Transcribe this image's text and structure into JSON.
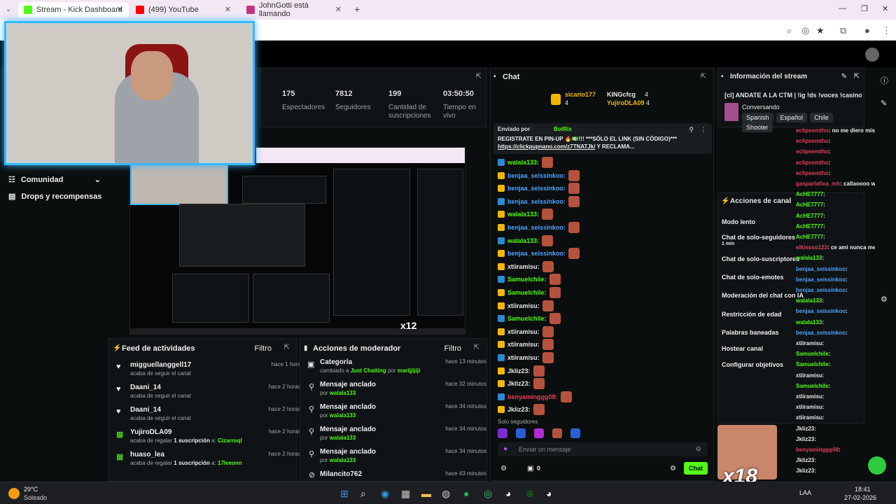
{
  "browser": {
    "tabs": [
      {
        "label": "Stream - Kick Dashboard",
        "active": true,
        "color": "#53fc18"
      },
      {
        "label": "(499) YouTube",
        "active": false,
        "color": "#ff0000"
      },
      {
        "label": "JohnGotti está llamando",
        "active": false,
        "color": "#c13584"
      }
    ],
    "new_tab": "+"
  },
  "stats": [
    {
      "value": "175",
      "label": "Espectadores"
    },
    {
      "value": "7812",
      "label": "Seguidores"
    },
    {
      "value": "199",
      "label": "Cantidad de suscripciones"
    },
    {
      "value": "03:50:50",
      "label": "Tiempo en vivo"
    }
  ],
  "sidebar": {
    "items": [
      {
        "label": "Comunidad",
        "icon": "users-icon"
      },
      {
        "label": "Drops y recompensas",
        "icon": "gift-icon"
      }
    ]
  },
  "activity_feed": {
    "title": "Feed de actividades",
    "filter": "Filtro",
    "rows": [
      {
        "name": "migguellanggell17",
        "sub": "acaba de seguir el canal",
        "time": "hace 1 hora",
        "type": "follow"
      },
      {
        "name": "Daani_14",
        "sub": "acaba de seguir el canal",
        "time": "hace 2 horas",
        "type": "follow"
      },
      {
        "name": "Daani_14",
        "sub": "acaba de seguir el canal",
        "time": "hace 2 horas",
        "type": "follow"
      },
      {
        "name": "YujiroDLA09",
        "sub_pre": "acaba de regalar",
        "sub_mid": "1 suscripción",
        "sub_post": "a:",
        "target": "Cizarroql",
        "time": "hace 2 horas",
        "type": "gift"
      },
      {
        "name": "huaso_lea",
        "sub_pre": "acaba de regalar",
        "sub_mid": "1 suscripción",
        "sub_post": "a:",
        "target": "17leeonn",
        "time": "hace 2 horas",
        "type": "gift"
      }
    ]
  },
  "mod_actions": {
    "title": "Acciones de moderador",
    "filter": "Filtro",
    "rows": [
      {
        "title": "Categoría",
        "sub_pre": "cambiado a",
        "sub_mid": "Just Chatting",
        "sub_post": "por",
        "by": "marijjijiji",
        "time": "hace 13 minutos"
      },
      {
        "title": "Mensaje anclado",
        "sub_pre": "por",
        "by": "walala133",
        "time": "hace 32 minutos"
      },
      {
        "title": "Mensaje anclado",
        "sub_pre": "por",
        "by": "walala133",
        "time": "hace 34 minutos"
      },
      {
        "title": "Mensaje anclado",
        "sub_pre": "por",
        "by": "walala133",
        "time": "hace 34 minutos"
      },
      {
        "title": "Mensaje anclado",
        "sub_pre": "por",
        "by": "walala133",
        "time": "hace 34 minutos"
      },
      {
        "title": "Milancito762",
        "time": "hace 43 minutos"
      }
    ]
  },
  "chat": {
    "title": "Chat",
    "leaders": [
      "sicario177",
      "KINGcfcg",
      "YujiroDLA09"
    ],
    "leader_counts": [
      "4",
      "4",
      "4"
    ],
    "pinned_by": "Enviado por",
    "pinned_user": "BotRix",
    "pinned_text": "REGISTRATE EN PIN-UP 🔥💵!!! ***SÓLO EL LINK (SIN CÓDIGO)***",
    "pinned_link": "https://clickpupnano.com/z7TNATJk/",
    "pinned_tail": "Y RECLAMA...",
    "messages": [
      {
        "user": "walala133:",
        "color": "#53fc18"
      },
      {
        "user": "benjaa_seissinkoo:",
        "color": "#4da3ff"
      },
      {
        "user": "benjaa_seissinkoo:",
        "color": "#4da3ff"
      },
      {
        "user": "benjaa_seissinkoo:",
        "color": "#4da3ff"
      },
      {
        "user": "walala133:",
        "color": "#53fc18"
      },
      {
        "user": "benjaa_seissinkoo:",
        "color": "#4da3ff"
      },
      {
        "user": "walala133:",
        "color": "#53fc18"
      },
      {
        "user": "benjaa_seissinkoo:",
        "color": "#4da3ff"
      },
      {
        "user": "xtiiramisu:",
        "color": "#e6e6e6"
      },
      {
        "user": "Samuelchile:",
        "color": "#53fc18"
      },
      {
        "user": "Samuelchile:",
        "color": "#53fc18"
      },
      {
        "user": "xtiiramisu:",
        "color": "#e6e6e6"
      },
      {
        "user": "Samuelchile:",
        "color": "#53fc18"
      },
      {
        "user": "xtiiramisu:",
        "color": "#e6e6e6"
      },
      {
        "user": "xtiiramisu:",
        "color": "#e6e6e6"
      },
      {
        "user": "xtiiramisu:",
        "color": "#e6e6e6"
      },
      {
        "user": "Jkliz23:",
        "color": "#e6e6e6"
      },
      {
        "user": "Jkliz23:",
        "color": "#e6e6e6"
      },
      {
        "user": "benyaminggg08:",
        "color": "#e0415a"
      },
      {
        "user": "Jkliz23:",
        "color": "#e6e6e6"
      }
    ],
    "followers_only": "Solo seguidores",
    "input_placeholder": "Enviar un mensaje",
    "points": "0",
    "send": "Chat"
  },
  "stream_info": {
    "title": "Información del stream",
    "stream_title": "[cl] ANDATE A LA CTM | !ig !ds !voces !casino",
    "category": "Conversando",
    "tags": [
      "Spanish",
      "Español",
      "Chile",
      "Shooter"
    ]
  },
  "channel_actions": {
    "title": "Acciones de canal",
    "items": [
      {
        "label": "Modo lento"
      },
      {
        "label": "Chat de solo-seguidores",
        "sub": "1 min"
      },
      {
        "label": "Chat de solo-suscriptores"
      },
      {
        "label": "Chat de solo-emotes"
      },
      {
        "label": "Moderación del chat con IA"
      },
      {
        "label": "Restricción de edad"
      },
      {
        "label": "Palabras baneadas"
      },
      {
        "label": "Hostear canal"
      },
      {
        "label": "Configurar objetivos"
      }
    ]
  },
  "side_chat": [
    {
      "user": "eclipsemtho",
      "text": ": no me diero mis puntos",
      "color": "#e0415a"
    },
    {
      "user": "eclipsemtho",
      "text": ":",
      "color": "#e0415a"
    },
    {
      "user": "eclipsemtho",
      "text": ":",
      "color": "#e0415a"
    },
    {
      "user": "eclipsemtho",
      "text": ":",
      "color": "#e0415a"
    },
    {
      "user": "eclipsemtho",
      "text": ":",
      "color": "#e0415a"
    },
    {
      "user": "gasparlafixa_mh",
      "text": ": callaoooo wn",
      "color": "#e0415a"
    },
    {
      "user": "AcHE7777",
      "text": ":",
      "color": "#53fc18"
    },
    {
      "user": "AcHE7777",
      "text": ":",
      "color": "#53fc18"
    },
    {
      "user": "AcHE7777",
      "text": ":",
      "color": "#53fc18"
    },
    {
      "user": "AcHE7777",
      "text": ":",
      "color": "#53fc18"
    },
    {
      "user": "AcHE7777",
      "text": ":",
      "color": "#53fc18"
    },
    {
      "user": "elkissso123",
      "text": ": ce ami nunca me llegaron los puntos wawa",
      "color": "#e0415a"
    },
    {
      "user": "walala133",
      "text": ":",
      "color": "#53fc18"
    },
    {
      "user": "benjaa_seissinkoo",
      "text": ":",
      "color": "#4da3ff"
    },
    {
      "user": "benjaa_seissinkoo",
      "text": ":",
      "color": "#4da3ff"
    },
    {
      "user": "benjaa_seissinkoo",
      "text": ":",
      "color": "#4da3ff"
    },
    {
      "user": "walala133",
      "text": ":",
      "color": "#53fc18"
    },
    {
      "user": "benjaa_seissinkoo",
      "text": ":",
      "color": "#4da3ff"
    },
    {
      "user": "walala133",
      "text": ":",
      "color": "#53fc18"
    },
    {
      "user": "benjaa_seissinkoo",
      "text": ":",
      "color": "#4da3ff"
    },
    {
      "user": "xtiiramisu",
      "text": ":",
      "color": "#e6e6e6"
    },
    {
      "user": "Samuelchile",
      "text": ":",
      "color": "#53fc18"
    },
    {
      "user": "Samuelchile",
      "text": ":",
      "color": "#53fc18"
    },
    {
      "user": "xtiiramisu",
      "text": ":",
      "color": "#e6e6e6"
    },
    {
      "user": "Samuelchile",
      "text": ":",
      "color": "#53fc18"
    },
    {
      "user": "xtiiramisu",
      "text": ":",
      "color": "#e6e6e6"
    },
    {
      "user": "xtiiramisu",
      "text": ":",
      "color": "#e6e6e6"
    },
    {
      "user": "xtiiramisu",
      "text": ":",
      "color": "#e6e6e6"
    },
    {
      "user": "Jkliz23",
      "text": ":",
      "color": "#e6e6e6"
    },
    {
      "user": "Jkliz23",
      "text": ":",
      "color": "#e6e6e6"
    },
    {
      "user": "benyaminggg08",
      "text": ":",
      "color": "#e0415a"
    },
    {
      "user": "Jkliz23",
      "text": ":",
      "color": "#e6e6e6"
    },
    {
      "user": "Jkliz23",
      "text": ":",
      "color": "#e6e6e6"
    }
  ],
  "overlays": {
    "x12": "x12",
    "x18": "x18"
  },
  "taskbar": {
    "weather_temp": "29°C",
    "weather_desc": "Soleado",
    "lang": "LAA",
    "time": "18:41",
    "date": "27-02-2026"
  },
  "colors": {
    "kick_green": "#53fc18",
    "panel_bg": "#101315",
    "webcam_border": "#3ab7ff"
  }
}
